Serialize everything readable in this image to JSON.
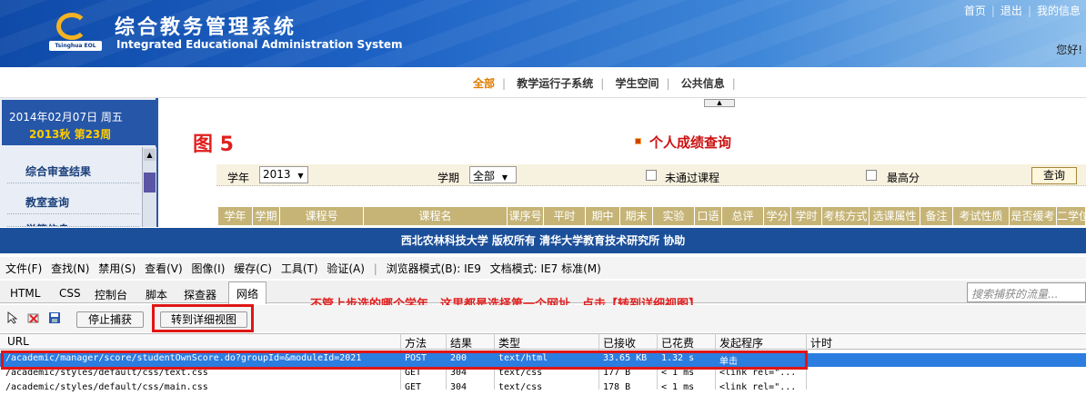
{
  "header": {
    "title_zh": "综合教务管理系统",
    "title_en": "Integrated Educational Administration System",
    "logo_text": "Tsinghua EOL",
    "links": [
      "首页",
      "退出",
      "我的信息"
    ],
    "greeting": "您好!"
  },
  "nav": {
    "items": [
      "全部",
      "教学运行子系统",
      "学生空间",
      "公共信息"
    ],
    "active": "全部",
    "collapse_icon": "▲"
  },
  "sidebar": {
    "date": "2014年02月07日  周五",
    "week": "2013秋 第23周",
    "items": [
      "综合审查结果",
      "教室查询",
      "学籍信息"
    ]
  },
  "page": {
    "figure_label": "图 5",
    "title": "个人成绩查询",
    "filter": {
      "year_label": "学年",
      "year_value": "2013",
      "term_label": "学期",
      "term_value": "全部",
      "failed_label": "未通过课程",
      "highest_label": "最高分",
      "query_button": "查询"
    },
    "table_headers": [
      "学年",
      "学期",
      "课程号",
      "课程名",
      "课序号",
      "平时",
      "期中",
      "期末",
      "实验",
      "口语",
      "总评",
      "学分",
      "学时",
      "考核方式",
      "选课属性",
      "备注",
      "考试性质",
      "是否缓考",
      "二学位"
    ]
  },
  "footer": {
    "text": "西北农林科技大学  版权所有  清华大学教育技术研究所  协助"
  },
  "devtools": {
    "menu": [
      "文件(F)",
      "查找(N)",
      "禁用(S)",
      "查看(V)",
      "图像(I)",
      "缓存(C)",
      "工具(T)",
      "验证(A)"
    ],
    "browser_mode": "浏览器模式(B): IE9",
    "doc_mode": "文档模式: IE7 标准(M)",
    "tabs": [
      "HTML",
      "CSS",
      "控制台",
      "脚本",
      "探查器",
      "网络"
    ],
    "active_tab": "网络",
    "search_placeholder": "搜索捕获的流量...",
    "stop_capture": "停止捕获",
    "detail_view": "转到详细视图",
    "annotation": "不管上步选的哪个学年，这里都是选择第一个网址，点击【转到详细视图】",
    "columns": [
      "URL",
      "方法",
      "结果",
      "类型",
      "已接收",
      "已花费",
      "发起程序",
      "计时"
    ],
    "rows": [
      {
        "url": "/academic/manager/score/studentOwnScore.do?groupId=&moduleId=2021",
        "method": "POST",
        "result": "200",
        "type": "text/html",
        "received": "33.65 KB",
        "taken": "1.32 s",
        "initiator": "单击"
      },
      {
        "url": "/academic/styles/default/css/text.css",
        "method": "GET",
        "result": "304",
        "type": "text/css",
        "received": "177 B",
        "taken": "< 1 ms",
        "initiator": "<link rel=\"..."
      },
      {
        "url": "/academic/styles/default/css/main.css",
        "method": "GET",
        "result": "304",
        "type": "text/css",
        "received": "178 B",
        "taken": "< 1 ms",
        "initiator": "<link rel=\"..."
      }
    ]
  }
}
